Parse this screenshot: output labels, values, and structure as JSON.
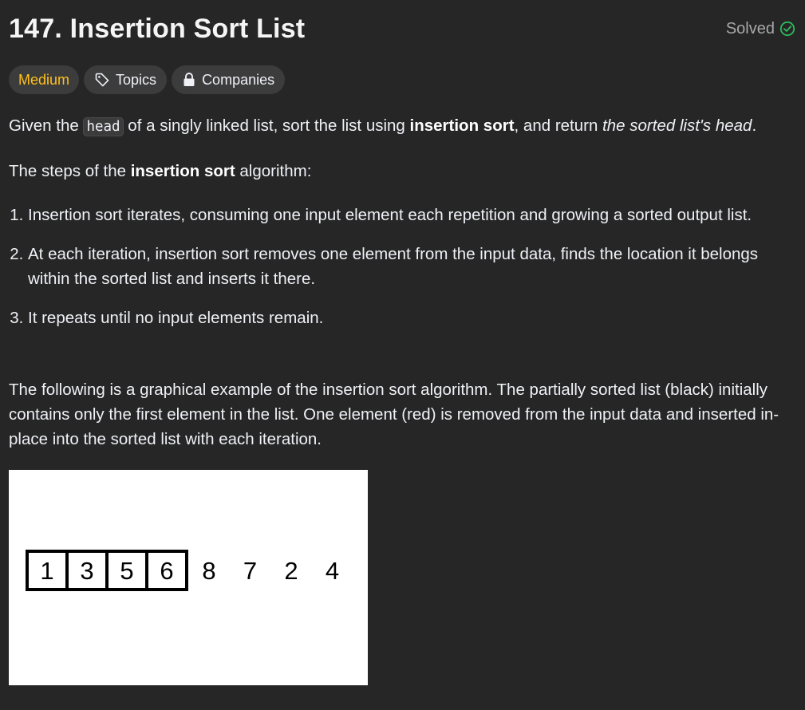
{
  "problem": {
    "title": "147. Insertion Sort List",
    "status": "Solved",
    "status_color": "#2cbb5d"
  },
  "tags": {
    "difficulty": "Medium",
    "topics": "Topics",
    "companies": "Companies"
  },
  "description": {
    "p1": {
      "a": "Given the ",
      "code": "head",
      "b": " of a singly linked list, sort the list using ",
      "bold": "insertion sort",
      "c": ", and return ",
      "italic": "the sorted list's head",
      "d": "."
    },
    "p2": {
      "a": "The steps of the ",
      "bold": "insertion sort",
      "b": " algorithm:"
    },
    "steps": [
      "Insertion sort iterates, consuming one input element each repetition and growing a sorted output list.",
      "At each iteration, insertion sort removes one element from the input data, finds the location it belongs within the sorted list and inserts it there.",
      "It repeats until no input elements remain."
    ],
    "p3": "The following is a graphical example of the insertion sort algorithm. The partially sorted list (black) initially contains only the first element in the list. One element (red) is removed from the input data and inserted in-place into the sorted list with each iteration."
  },
  "figure": {
    "sorted": [
      "1",
      "3",
      "5",
      "6"
    ],
    "unsorted": [
      "8",
      "7",
      "2",
      "4"
    ]
  }
}
